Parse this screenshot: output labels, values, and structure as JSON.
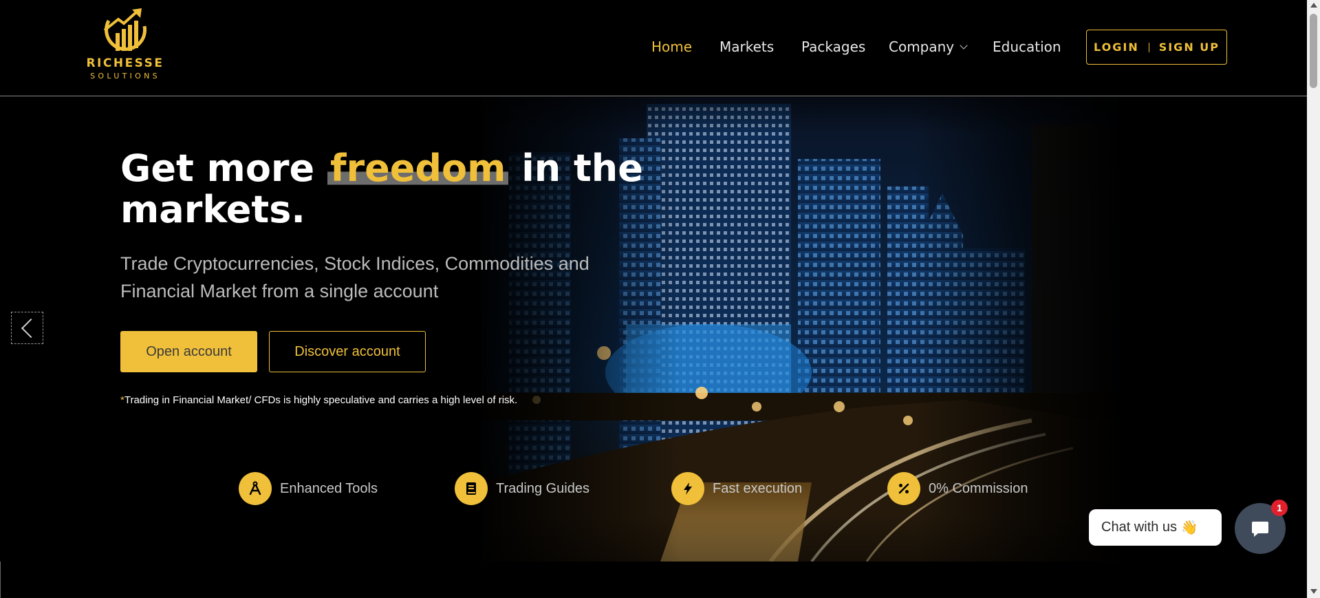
{
  "brand": {
    "name": "RICHESSE",
    "subtitle": "SOLUTIONS",
    "color": "#f0c03a"
  },
  "nav": {
    "items": [
      {
        "label": "Home",
        "active": true
      },
      {
        "label": "Markets"
      },
      {
        "label": "Packages"
      },
      {
        "label": "Company",
        "dropdown": true
      },
      {
        "label": "Education"
      }
    ],
    "login": "LOGIN",
    "signup": "SIGN UP"
  },
  "hero": {
    "headline_pre": "Get more",
    "headline_highlight": "freedom",
    "headline_post": "in the markets.",
    "subline": "Trade Cryptocurrencies, Stock Indices, Commodities and Financial Market from a single account",
    "open_account": "Open account",
    "discover_account": "Discover account",
    "risk_star": "*",
    "risk_text": "Trading in Financial Market/ CFDs is highly speculative and carries a high level of risk."
  },
  "features": [
    {
      "label": "Enhanced Tools",
      "icon": "compass-tools-icon"
    },
    {
      "label": "Trading Guides",
      "icon": "book-icon"
    },
    {
      "label": "Fast execution",
      "icon": "lightning-icon"
    },
    {
      "label": "0% Commission",
      "icon": "percent-icon"
    }
  ],
  "chat": {
    "label": "Chat with us",
    "emoji": "👋",
    "badge": "1"
  },
  "colors": {
    "accent": "#f0c03a",
    "background": "#000000",
    "chat_button": "#3f4a5a",
    "badge": "#e0202d"
  }
}
